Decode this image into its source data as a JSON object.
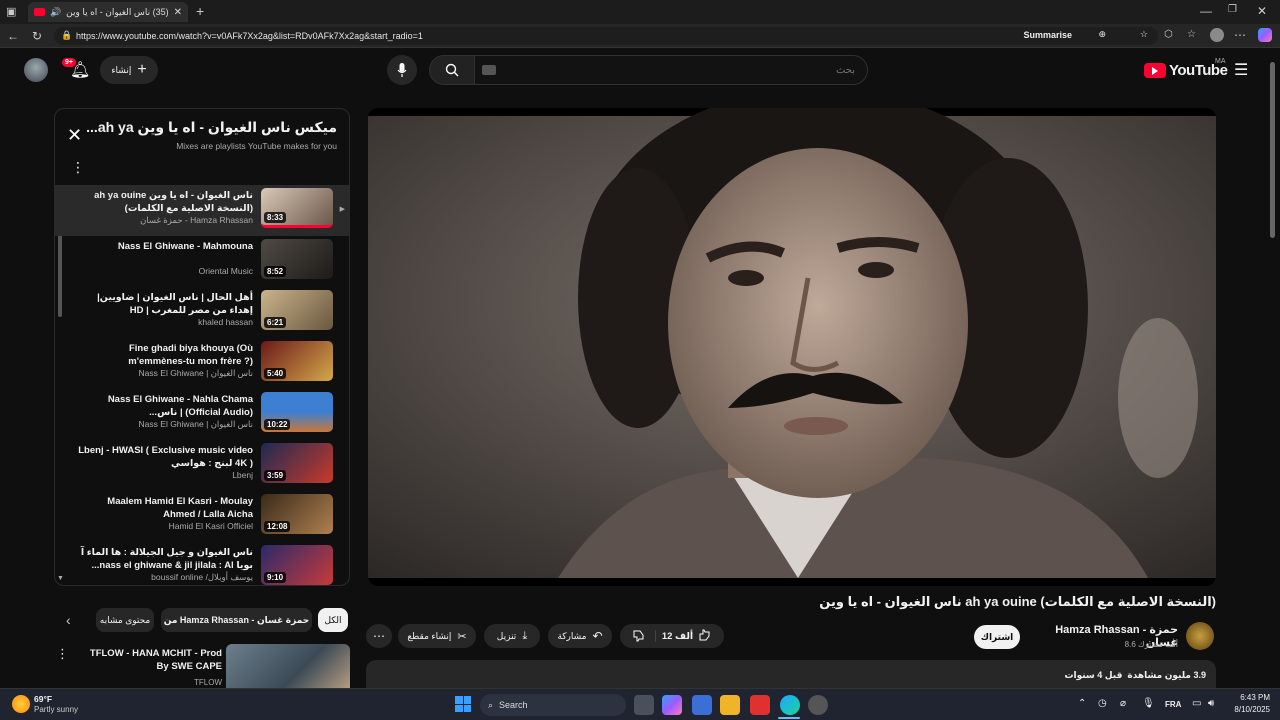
{
  "browser": {
    "tab_title": "(35) ناس الغيوان - اه يا وين",
    "url": "https://www.youtube.com/watch?v=v0AFk7Xx2ag&list=RDv0AFk7Xx2ag&start_radio=1",
    "summarise_label": "Summarise"
  },
  "header": {
    "notification_count": "9+",
    "create_label": "إنشاء",
    "search_placeholder": "بحث",
    "logo_text": "YouTube",
    "logo_country": "MA"
  },
  "playlist": {
    "title": "ميكس ناس الغيوان - اه يا وين ah ya...",
    "subtitle": "Mixes are playlists YouTube makes for you",
    "items": [
      {
        "title": "ناس الغيوان - اه يا وين ah ya ouine (النسخة الاصلية مع الكلمات)",
        "channel": "حمزة غسان - Hamza Rhassan",
        "duration": "8:33"
      },
      {
        "title": "Nass El Ghiwane - Mahmouna",
        "channel": "Oriental Music",
        "duration": "8:52"
      },
      {
        "title": "أهل الحال | ناس الغيوان | ضاويين| إهداء من مصر للمغرب | HD",
        "channel": "khaled hassan",
        "duration": "6:21"
      },
      {
        "title": "Fine ghadi biya khouya (Où m'emmènes-tu mon frère ?)",
        "channel": "Nass El Ghiwane | ناس الغيوان",
        "duration": "5:40"
      },
      {
        "title": "Nass El Ghiwane - Nahla Chama (Official Audio) | ناس...",
        "channel": "Nass El Ghiwane | ناس الغيوان",
        "duration": "10:22"
      },
      {
        "title": "Lbenj - HWASI ( Exclusive music video 4K ) لبنج : هواسي",
        "channel": "Lbenj",
        "duration": "3:59"
      },
      {
        "title": "Maalem Hamid El Kasri - Moulay Ahmed / Lalla Aicha",
        "channel": "Hamid El Kasri Officiel",
        "duration": "12:08"
      },
      {
        "title": "ناس الغيوان و جيل الجيلالة : ها الماء آ بويا nass el ghiwane & jil jilala : Al...",
        "channel": "boussif online /يوسف أوبلال",
        "duration": "9:10"
      }
    ]
  },
  "chips": {
    "all": "الكل",
    "from_channel": "من Hamza Rhassan - حمزة غسان",
    "related": "محتوى مشابه"
  },
  "recommendation": {
    "title": "TFLOW - HANA MCHIT - Prod By SWE CAPE",
    "channel": "TFLOW"
  },
  "video": {
    "title": "ناس الغيوان - اه يا وين ah ya ouine (النسخة الاصلية مع الكلمات)",
    "channel_name": "Hamza Rhassan - حمزة غسان",
    "subscribers": "8.6 ألف مشترك",
    "subscribe_label": "اشتراك",
    "like_count": "12 ألف",
    "share_label": "مشاركة",
    "download_label": "تنزيل",
    "clip_label": "إنشاء مقطع",
    "views": "3.9 مليون مشاهدة",
    "date": "قبل 4 سنوات"
  },
  "taskbar": {
    "temp": "69°F",
    "weather": "Partly sunny",
    "search_label": "Search",
    "lang": "FRA",
    "time": "6:43 PM",
    "date": "8/10/2025"
  },
  "colors": {
    "accent_red": "#ff0033",
    "bg": "#0f0f0f"
  }
}
